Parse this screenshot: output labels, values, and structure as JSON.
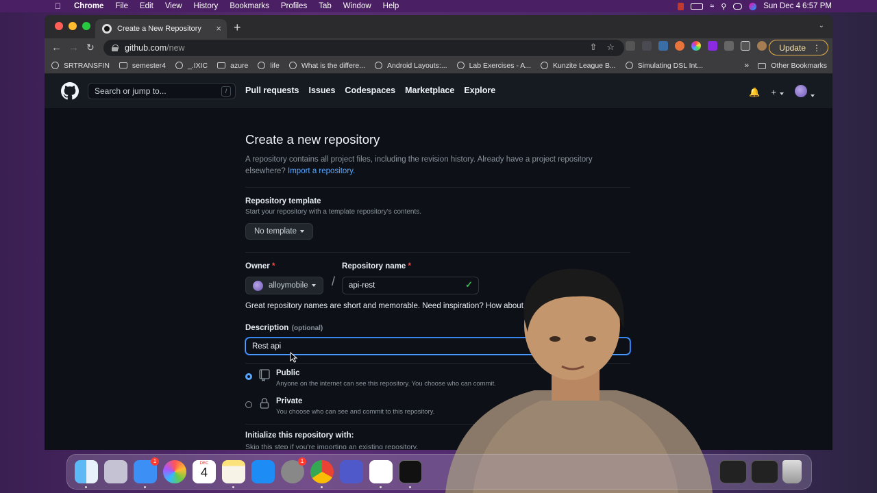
{
  "menubar": {
    "app": "Chrome",
    "items": [
      "File",
      "Edit",
      "View",
      "History",
      "Bookmarks",
      "Profiles",
      "Tab",
      "Window",
      "Help"
    ],
    "clock": "Sun Dec 4  6:57 PM"
  },
  "browser": {
    "tab_title": "Create a New Repository",
    "url_host": "github.com",
    "url_path": "/new",
    "update_label": "Update",
    "bookmarks": [
      "SRTRANSFIN",
      "semester4",
      "_.IXIC",
      "azure",
      "life",
      "What is the differe...",
      "Android Layouts:...",
      "Lab Exercises - A...",
      "Kunzite League B...",
      "Simulating DSL Int..."
    ],
    "other_bookmarks": "Other Bookmarks"
  },
  "github": {
    "search_placeholder": "Search or jump to...",
    "search_shortcut": "/",
    "nav": [
      "Pull requests",
      "Issues",
      "Codespaces",
      "Marketplace",
      "Explore"
    ]
  },
  "page": {
    "title": "Create a new repository",
    "intro": "A repository contains all project files, including the revision history. Already have a project repository elsewhere?",
    "import_link": "Import a repository.",
    "template_label": "Repository template",
    "template_sub": "Start your repository with a template repository's contents.",
    "template_value": "No template",
    "owner_label": "Owner",
    "required_mark": "*",
    "owner_value": "alloymobile",
    "repo_name_label": "Repository name",
    "repo_name_value": "api-rest",
    "name_hint": "Great repository names are short and memorable. Need inspiration? How about",
    "description_label": "Description",
    "description_optional": "(optional)",
    "description_value": "Rest api",
    "public_title": "Public",
    "public_desc": "Anyone on the internet can see this repository. You choose who can commit.",
    "private_title": "Private",
    "private_desc": "You choose who can see and commit to this repository.",
    "init_title": "Initialize this repository with:",
    "init_sub": "Skip this step if you're importing an existing repository."
  },
  "dock": {
    "calendar_month": "DEC",
    "calendar_day": "4",
    "badges": [
      "1",
      "1"
    ]
  }
}
